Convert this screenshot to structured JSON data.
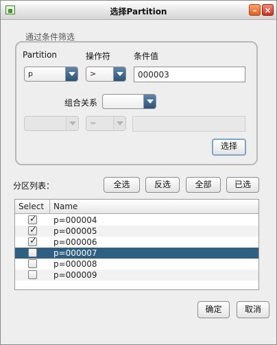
{
  "window": {
    "title": "选择Partition"
  },
  "filter": {
    "group_title": "通过条件筛选",
    "col_partition_label": "Partition",
    "col_operator_label": "操作符",
    "col_value_label": "条件值",
    "partition_value": "p",
    "operator_value": ">",
    "condition_value": "000003",
    "combine_label": "组合关系",
    "combine_value": "",
    "row2_partition_value": "",
    "row2_operator_value": "=",
    "row2_condition_value": "",
    "select_button": "选择"
  },
  "list": {
    "label": "分区列表：",
    "buttons": {
      "all": "全选",
      "invert": "反选",
      "whole": "全部",
      "selected": "已选"
    },
    "columns": [
      "Select",
      "Name"
    ],
    "rows": [
      {
        "name": "p=000004",
        "checked": true,
        "selected": false
      },
      {
        "name": "p=000005",
        "checked": true,
        "selected": false
      },
      {
        "name": "p=000006",
        "checked": true,
        "selected": false
      },
      {
        "name": "p=000007",
        "checked": false,
        "selected": true
      },
      {
        "name": "p=000008",
        "checked": false,
        "selected": false
      },
      {
        "name": "p=000009",
        "checked": false,
        "selected": false
      }
    ]
  },
  "footer": {
    "ok": "确定",
    "cancel": "取消"
  },
  "colors": {
    "selection": "#2f5f82",
    "combo_arrow": "#3f6a90"
  }
}
